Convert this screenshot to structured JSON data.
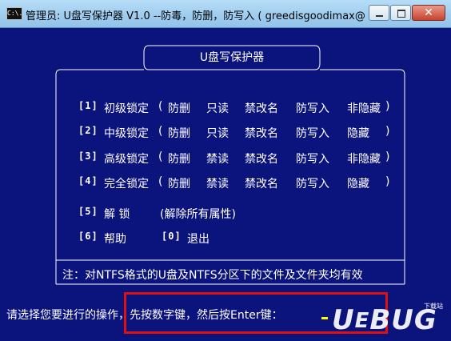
{
  "window": {
    "title": "管理员:  U盘写保护器 V1.0  --防毒，防删，防写入 ( greedisgoodimax@sin...",
    "icon_label": "C:\\.",
    "buttons": {
      "minimize": "minimize-icon",
      "maximize": "maximize-icon",
      "close": "✕"
    }
  },
  "console": {
    "header_title": "U盘写保护器",
    "menu": [
      {
        "key": "[1]",
        "name": "初级锁定",
        "open": "(",
        "opts": [
          "防删",
          "只读",
          "禁改名",
          "防写入",
          "非隐藏"
        ],
        "close": ")"
      },
      {
        "key": "[2]",
        "name": "中级锁定",
        "open": "(",
        "opts": [
          "防删",
          "只读",
          "禁改名",
          "防写入",
          "隐藏"
        ],
        "close": ")"
      },
      {
        "key": "[3]",
        "name": "高级锁定",
        "open": "(",
        "opts": [
          "防删",
          "禁读",
          "禁改名",
          "防写入",
          "非隐藏"
        ],
        "close": ")"
      },
      {
        "key": "[4]",
        "name": "完全锁定",
        "open": "(",
        "opts": [
          "防删",
          "禁读",
          "禁改名",
          "防写入",
          "隐藏"
        ],
        "close": ")"
      }
    ],
    "unlock": {
      "key": "[5]",
      "name": "解  锁",
      "desc": "(解除所有属性)"
    },
    "help": {
      "key": "[6]",
      "name": "帮助"
    },
    "exit": {
      "key": "[0]",
      "name": "退出"
    },
    "note": "注：对NTFS格式的U盘及NTFS分区下的文件及文件夹均有效",
    "prompt": "请选择您要进行的操作，先按数字键，然后按Enter键："
  },
  "watermark": {
    "text": "UEBUG",
    "sub": "下载站"
  },
  "colors": {
    "console_bg": "#0b137c",
    "text": "#ffffff",
    "cursor": "#ffff00",
    "highlight": "#e01010"
  }
}
